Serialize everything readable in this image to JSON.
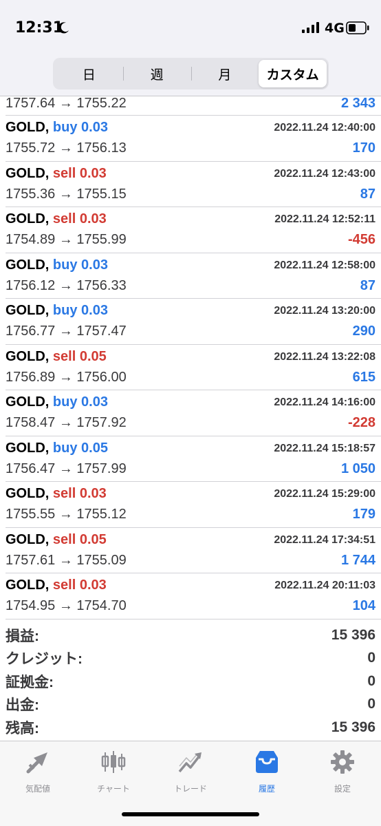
{
  "status": {
    "time": "12:31",
    "network": "4G"
  },
  "segments": [
    {
      "label": "日",
      "active": false
    },
    {
      "label": "週",
      "active": false
    },
    {
      "label": "月",
      "active": false
    },
    {
      "label": "カスタム",
      "active": true
    }
  ],
  "partial_trade": {
    "open": "1757.64",
    "close": "1755.22",
    "profit": "2 343"
  },
  "trades": [
    {
      "symbol": "GOLD,",
      "type": "buy",
      "volume": "0.03",
      "time": "2022.11.24 12:40:00",
      "open": "1755.72",
      "close": "1756.13",
      "profit": "170"
    },
    {
      "symbol": "GOLD,",
      "type": "sell",
      "volume": "0.03",
      "time": "2022.11.24 12:43:00",
      "open": "1755.36",
      "close": "1755.15",
      "profit": "87"
    },
    {
      "symbol": "GOLD,",
      "type": "sell",
      "volume": "0.03",
      "time": "2022.11.24 12:52:11",
      "open": "1754.89",
      "close": "1755.99",
      "profit": "-456"
    },
    {
      "symbol": "GOLD,",
      "type": "buy",
      "volume": "0.03",
      "time": "2022.11.24 12:58:00",
      "open": "1756.12",
      "close": "1756.33",
      "profit": "87"
    },
    {
      "symbol": "GOLD,",
      "type": "buy",
      "volume": "0.03",
      "time": "2022.11.24 13:20:00",
      "open": "1756.77",
      "close": "1757.47",
      "profit": "290"
    },
    {
      "symbol": "GOLD,",
      "type": "sell",
      "volume": "0.05",
      "time": "2022.11.24 13:22:08",
      "open": "1756.89",
      "close": "1756.00",
      "profit": "615"
    },
    {
      "symbol": "GOLD,",
      "type": "buy",
      "volume": "0.03",
      "time": "2022.11.24 14:16:00",
      "open": "1758.47",
      "close": "1757.92",
      "profit": "-228"
    },
    {
      "symbol": "GOLD,",
      "type": "buy",
      "volume": "0.05",
      "time": "2022.11.24 15:18:57",
      "open": "1756.47",
      "close": "1757.99",
      "profit": "1 050"
    },
    {
      "symbol": "GOLD,",
      "type": "sell",
      "volume": "0.03",
      "time": "2022.11.24 15:29:00",
      "open": "1755.55",
      "close": "1755.12",
      "profit": "179"
    },
    {
      "symbol": "GOLD,",
      "type": "sell",
      "volume": "0.05",
      "time": "2022.11.24 17:34:51",
      "open": "1757.61",
      "close": "1755.09",
      "profit": "1 744"
    },
    {
      "symbol": "GOLD,",
      "type": "sell",
      "volume": "0.03",
      "time": "2022.11.24 20:11:03",
      "open": "1754.95",
      "close": "1754.70",
      "profit": "104"
    }
  ],
  "summary": [
    {
      "label": "損益:",
      "value": "15 396"
    },
    {
      "label": "クレジット:",
      "value": "0"
    },
    {
      "label": "証拠金:",
      "value": "0"
    },
    {
      "label": "出金:",
      "value": "0"
    },
    {
      "label": "残高:",
      "value": "15 396"
    }
  ],
  "tabs": [
    {
      "label": "気配値",
      "icon": "quotes-arrows-icon",
      "active": false
    },
    {
      "label": "チャート",
      "icon": "candlestick-chart-icon",
      "active": false
    },
    {
      "label": "トレード",
      "icon": "trade-trend-icon",
      "active": false
    },
    {
      "label": "履歴",
      "icon": "history-inbox-icon",
      "active": true
    },
    {
      "label": "設定",
      "icon": "settings-gear-icon",
      "active": false
    }
  ],
  "colors": {
    "buy": "#2a78e4",
    "sell": "#d23b33",
    "accent": "#2a78e4"
  },
  "arrow": "→"
}
